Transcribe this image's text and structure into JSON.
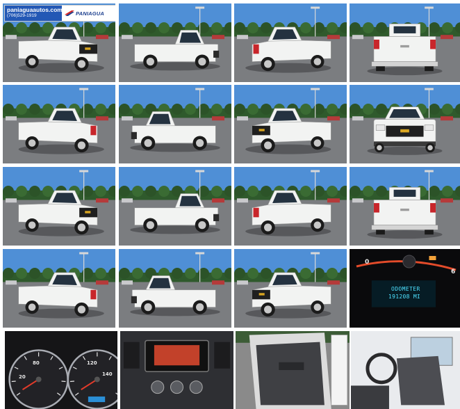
{
  "dealer": {
    "domain": "paniaguaautos.com",
    "phone": "(706)529-1919",
    "brand": "PANIAGUA"
  },
  "vehicle": {
    "color": "#f2f3f2",
    "bowtie_color": "#d9a520"
  },
  "gallery": {
    "photos": [
      {
        "name": "photo-front-left-watermark",
        "view": "front-left"
      },
      {
        "name": "photo-side-left",
        "view": "side-left"
      },
      {
        "name": "photo-rear-left",
        "view": "rear-left"
      },
      {
        "name": "photo-rear",
        "view": "rear"
      },
      {
        "name": "photo-rear-right",
        "view": "rear-right"
      },
      {
        "name": "photo-side-right",
        "view": "side-right"
      },
      {
        "name": "photo-front-right",
        "view": "front-right"
      },
      {
        "name": "photo-front",
        "view": "front"
      },
      {
        "name": "photo-front-left-2",
        "view": "front-left"
      },
      {
        "name": "photo-side-left-2",
        "view": "side-left"
      },
      {
        "name": "photo-rear-left-2",
        "view": "rear-left"
      },
      {
        "name": "photo-rear-2",
        "view": "rear"
      },
      {
        "name": "photo-rear-right-2",
        "view": "rear-right"
      },
      {
        "name": "photo-side-right-2",
        "view": "side-right"
      },
      {
        "name": "photo-front-right-2",
        "view": "front-right"
      },
      {
        "name": "photo-odometer",
        "view": "odometer"
      },
      {
        "name": "photo-gauges",
        "view": "gauges"
      },
      {
        "name": "photo-dash-center",
        "view": "dash"
      },
      {
        "name": "photo-door-panel",
        "view": "door"
      },
      {
        "name": "photo-interior-seat",
        "view": "seat"
      }
    ]
  },
  "odometer": {
    "label": "ODOMETER",
    "value": "191208 MI",
    "scale_left": "0",
    "scale_right": "6"
  },
  "gauges": {
    "speedo_top": "80",
    "speedo_left": "20",
    "tach_top": "120",
    "tach_right": "140"
  }
}
